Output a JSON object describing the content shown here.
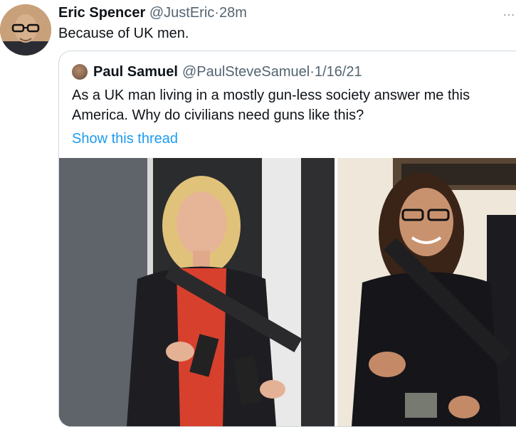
{
  "tweet": {
    "author_name": "Eric Spencer",
    "author_handle": "@JustEric",
    "separator": "·",
    "time": "28m",
    "text": "Because of UK men.",
    "more_icon": "…"
  },
  "quoted_tweet": {
    "author_name": "Paul Samuel",
    "author_handle": "@PaulSteveSamuel",
    "separator": "·",
    "date": "1/16/21",
    "text": "As a UK man living in a mostly gun-less society answer me this America. Why do civilians need guns like this?",
    "show_thread_label": "Show this thread",
    "media": [
      {
        "name": "left-photo",
        "description_icon": "woman-holding-rifle-photo"
      },
      {
        "name": "right-photo",
        "description_icon": "woman-holding-rifle-photo"
      }
    ]
  },
  "colors": {
    "link_blue": "#1d9bf0",
    "text_primary": "#0f1419",
    "text_secondary": "#536471",
    "border": "#cfd9de"
  }
}
